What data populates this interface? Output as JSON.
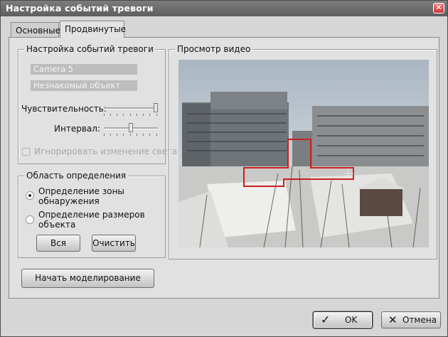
{
  "window": {
    "title": "Настройка событий тревоги",
    "close_glyph": "✕"
  },
  "tabs": [
    {
      "label": "Основные",
      "active": false
    },
    {
      "label": "Продвинутые",
      "active": true
    }
  ],
  "alarm_settings": {
    "legend": "Настройка событий тревоги",
    "camera": "Camera 5",
    "object": "Незнакомый объект",
    "sensitivity_label": "Чувствительность:",
    "sensitivity_value": 1.0,
    "interval_label": "Интервал:",
    "interval_value": 0.5,
    "ignore_light_label": "Игнорировать изменение света",
    "ignore_light_checked": false
  },
  "detection_area": {
    "legend": "Область определения",
    "options": [
      {
        "label_line1": "Определение зоны",
        "label_line2": "обнаружения",
        "selected": true
      },
      {
        "label_line1": "Определение размеров",
        "label_line2": "объекта",
        "selected": false
      }
    ],
    "all_button": "Вся",
    "clear_button": "Очистить"
  },
  "simulate_button": "Начать моделирование",
  "preview": {
    "legend": "Просмотр видео",
    "zone_color": "#cc1f1f"
  },
  "footer": {
    "ok_label": "OK",
    "cancel_label": "Отмена",
    "ok_icon": "check-icon",
    "cancel_icon": "x-icon"
  }
}
